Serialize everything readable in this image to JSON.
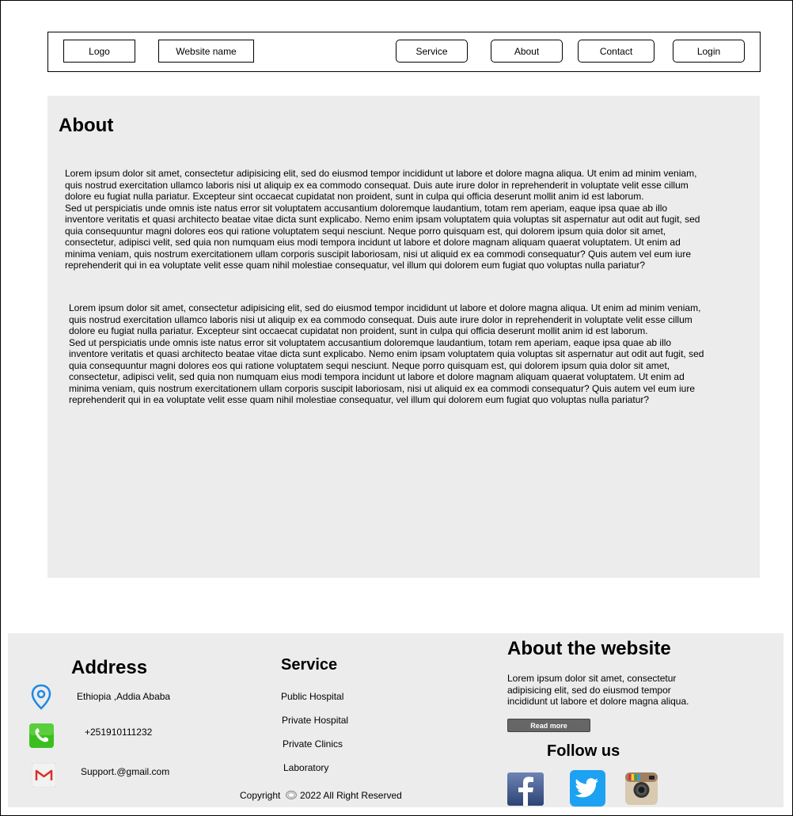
{
  "nav": {
    "logo": "Logo",
    "site_name": "Website name",
    "items": [
      {
        "label": "Service"
      },
      {
        "label": "About"
      },
      {
        "label": "Contact"
      },
      {
        "label": "Login"
      }
    ]
  },
  "about": {
    "title": "About",
    "paragraphs": [
      "Lorem ipsum dolor sit amet, consectetur adipisicing elit, sed do eiusmod tempor incididunt ut labore et dolore magna aliqua. Ut enim ad minim veniam,\nquis nostrud exercitation ullamco laboris nisi ut aliquip ex ea commodo consequat. Duis aute irure dolor in reprehenderit in voluptate velit esse cillum\ndolore eu fugiat nulla pariatur. Excepteur sint occaecat cupidatat non proident, sunt in culpa qui officia deserunt mollit anim id est laborum.\nSed ut perspiciatis unde omnis iste natus error sit voluptatem accusantium doloremque laudantium, totam rem aperiam, eaque ipsa quae ab illo\ninventore veritatis et quasi architecto beatae vitae dicta sunt explicabo. Nemo enim ipsam voluptatem quia voluptas sit aspernatur aut odit aut fugit, sed\nquia consequuntur magni dolores eos qui ratione voluptatem sequi nesciunt. Neque porro quisquam est, qui dolorem ipsum quia dolor sit amet,\nconsectetur, adipisci velit, sed quia non numquam eius modi tempora incidunt ut labore et dolore magnam aliquam quaerat voluptatem. Ut enim ad\nminima veniam, quis nostrum exercitationem ullam corporis suscipit laboriosam, nisi ut aliquid ex ea commodi consequatur? Quis autem vel eum iure\nreprehenderit qui in ea voluptate velit esse quam nihil molestiae consequatur, vel illum qui dolorem eum fugiat quo voluptas nulla pariatur?",
      "Lorem ipsum dolor sit amet, consectetur adipisicing elit, sed do eiusmod tempor incididunt ut labore et dolore magna aliqua. Ut enim ad minim veniam,\nquis nostrud exercitation ullamco laboris nisi ut aliquip ex ea commodo consequat. Duis aute irure dolor in reprehenderit in voluptate velit esse cillum\ndolore eu fugiat nulla pariatur. Excepteur sint occaecat cupidatat non proident, sunt in culpa qui officia deserunt mollit anim id est laborum.\nSed ut perspiciatis unde omnis iste natus error sit voluptatem accusantium doloremque laudantium, totam rem aperiam, eaque ipsa quae ab illo\ninventore veritatis et quasi architecto beatae vitae dicta sunt explicabo. Nemo enim ipsam voluptatem quia voluptas sit aspernatur aut odit aut fugit, sed\nquia consequuntur magni dolores eos qui ratione voluptatem sequi nesciunt. Neque porro quisquam est, qui dolorem ipsum quia dolor sit amet,\nconsectetur, adipisci velit, sed quia non numquam eius modi tempora incidunt ut labore et dolore magnam aliquam quaerat voluptatem. Ut enim ad\nminima veniam, quis nostrum exercitationem ullam corporis suscipit laboriosam, nisi ut aliquid ex ea commodi consequatur? Quis autem vel eum iure\nreprehenderit qui in ea voluptate velit esse quam nihil molestiae consequatur, vel illum qui dolorem eum fugiat quo voluptas nulla pariatur?"
    ]
  },
  "footer": {
    "address": {
      "title": "Address",
      "location": "Ethiopia ,Addia Ababa",
      "phone": "+251910111232",
      "email": "Support.@gmail.com"
    },
    "service": {
      "title": "Service",
      "items": [
        "Public Hospital",
        "Private Hospital",
        "Private Clinics",
        "Laboratory"
      ]
    },
    "about_site": {
      "title": "About the website",
      "text": "Lorem ipsum dolor sit amet, consectetur\nadipisicing elit, sed do eiusmod tempor\nincididunt ut labore et dolore magna aliqua.",
      "read_more": "Read more"
    },
    "follow": {
      "title": "Follow us",
      "icons": [
        "facebook-icon",
        "twitter-icon",
        "instagram-icon"
      ]
    },
    "copyright": "Copyright",
    "copyright_rest": "2022 All Right Reserved"
  },
  "colors": {
    "panel_bg": "#ececec",
    "facebook": "#3b5998",
    "twitter": "#1da1f2",
    "phone_green": "#3bbf1f",
    "location_blue": "#1e88e5"
  }
}
